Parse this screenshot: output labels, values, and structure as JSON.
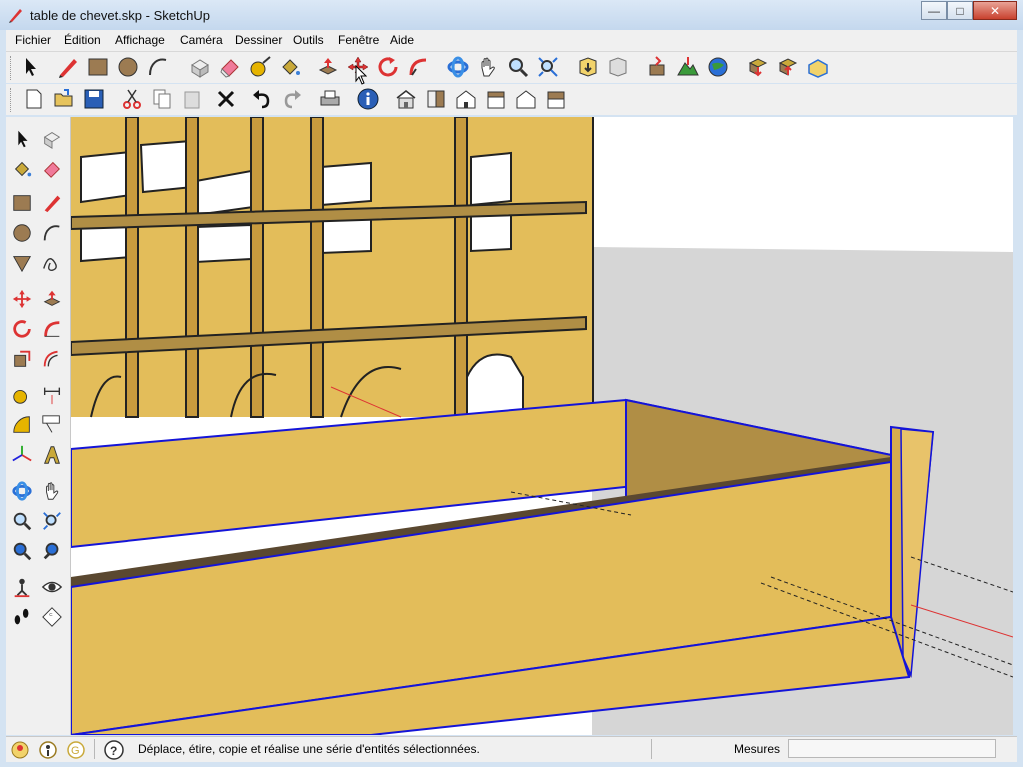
{
  "window": {
    "title": "table de chevet.skp - SketchUp",
    "buttons": {
      "minimize": "—",
      "maximize": "□",
      "close": "✕"
    }
  },
  "menu": [
    "Fichier",
    "Édition",
    "Affichage",
    "Caméra",
    "Dessiner",
    "Outils",
    "Fenêtre",
    "Aide"
  ],
  "toolbar1": [
    "select-icon",
    "pencil-icon",
    "rectangle-icon",
    "circle-icon",
    "arc-icon",
    "make-component-icon",
    "eraser-icon",
    "tape-measure-icon",
    "paint-bucket-icon",
    "push-pull-icon",
    "move-icon",
    "rotate-icon",
    "follow-me-icon",
    "orbit-icon",
    "pan-icon",
    "zoom-icon",
    "zoom-extents-icon",
    "get-models-icon",
    "share-model-icon",
    "add-location-icon",
    "toggle-terrain-icon",
    "google-earth-icon",
    "get-components-icon",
    "share-component-icon",
    "photo-textures-icon"
  ],
  "toolbar2": [
    "new-icon",
    "open-icon",
    "save-icon",
    "cut-icon",
    "copy-icon",
    "paste-icon",
    "delete-icon",
    "undo-icon",
    "redo-icon",
    "print-icon",
    "model-info-icon",
    "iso-view-icon",
    "top-view-icon",
    "front-view-icon",
    "right-view-icon",
    "back-view-icon",
    "left-view-icon"
  ],
  "status": {
    "message": "Déplace, étire, copie et réalise une série d'entités sélectionnées.",
    "measures_label": "Mesures",
    "measures_value": ""
  },
  "colors": {
    "wood": "#e3bd5a",
    "wood_shade": "#b08e45",
    "selection": "#1414d8",
    "sky": "#ffffff",
    "ground": "#d6d6d6"
  }
}
